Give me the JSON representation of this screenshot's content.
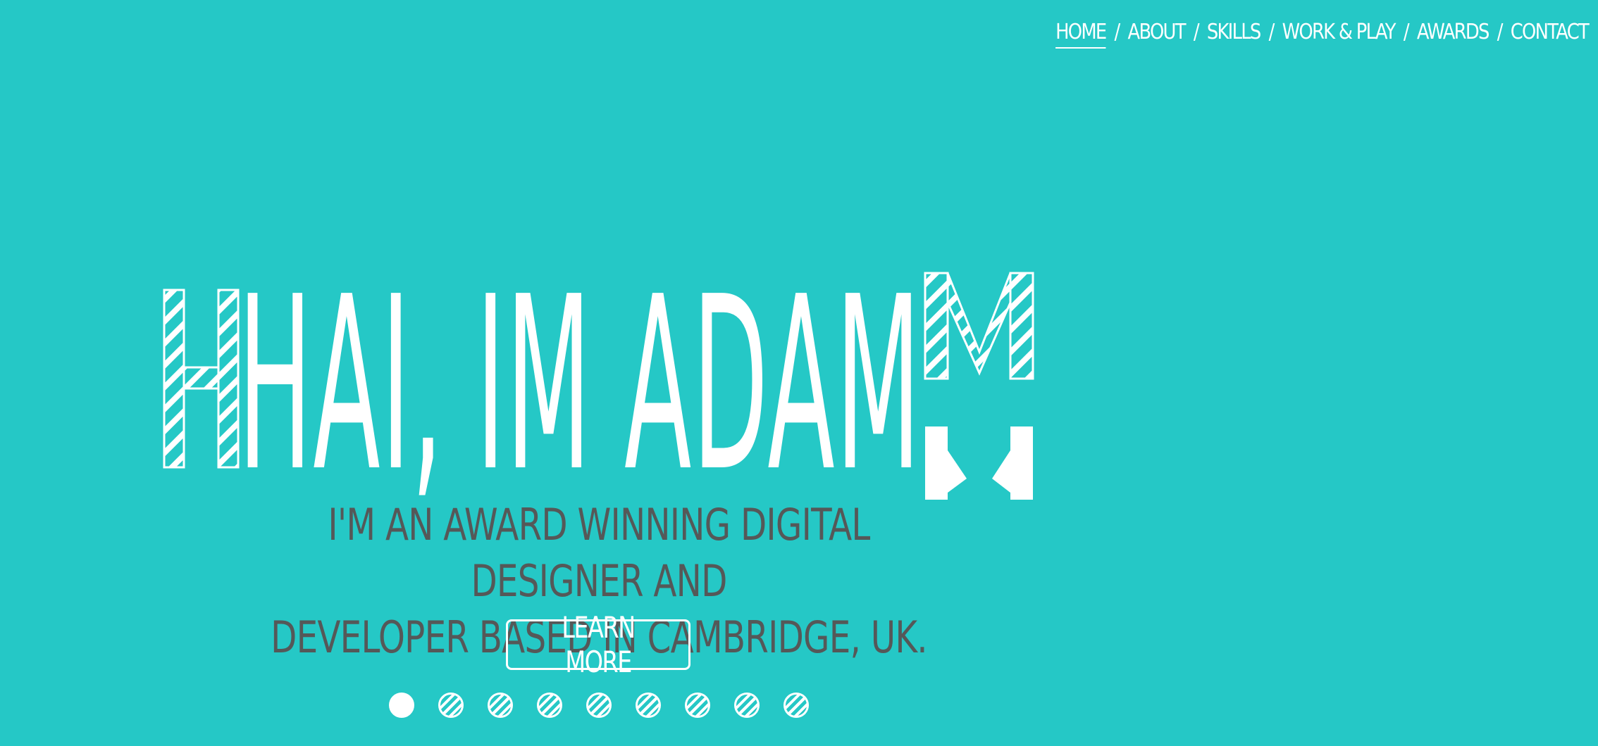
{
  "nav": {
    "items": [
      {
        "label": "HOME",
        "active": true
      },
      {
        "label": "ABOUT",
        "active": false
      },
      {
        "label": "SKILLS",
        "active": false
      },
      {
        "label": "WORK & PLAY",
        "active": false
      },
      {
        "label": "AWARDS",
        "active": false
      },
      {
        "label": "CONTACT",
        "active": false
      }
    ],
    "separator": "/"
  },
  "hero": {
    "headline": "HAI, IM ADAM"
  },
  "tagline": {
    "line1": "I'M AN AWARD WINNING DIGITAL DESIGNER AND",
    "line2": "DEVELOPER BASED IN CAMBRIDGE, UK."
  },
  "cta": {
    "learn_more_label": "LEARN MORE"
  },
  "slider": {
    "dot_count": 9,
    "active_index": 0
  },
  "colors": {
    "background": "#25c8c6",
    "primary_text": "#ffffff",
    "tagline_text": "#555858"
  }
}
